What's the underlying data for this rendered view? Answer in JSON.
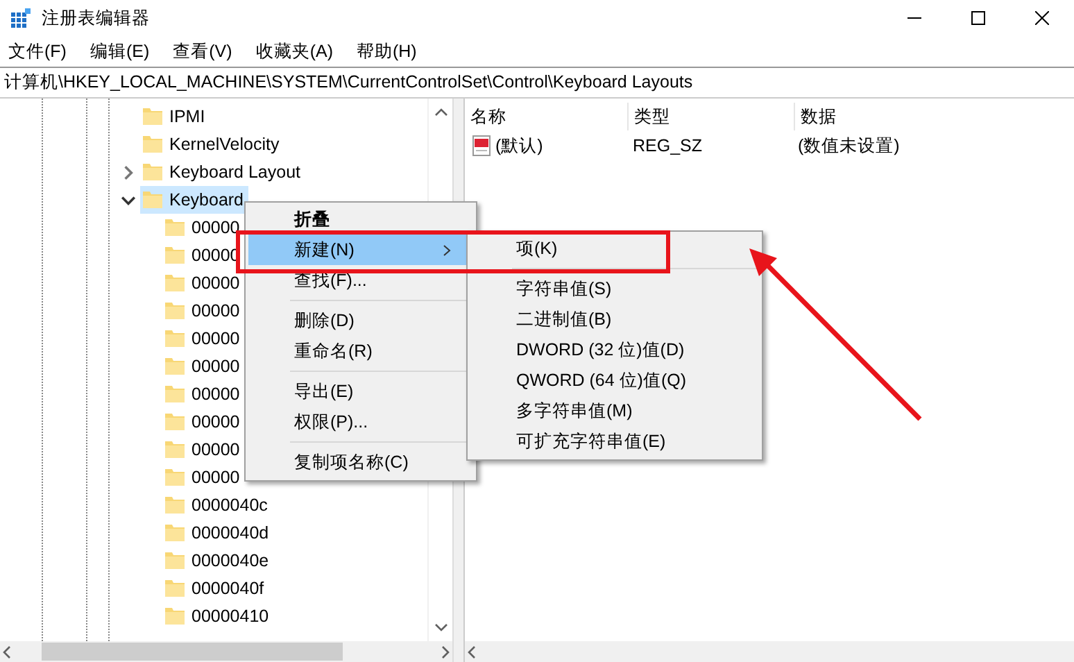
{
  "window": {
    "title": "注册表编辑器"
  },
  "menu_bar": [
    "文件(F)",
    "编辑(E)",
    "查看(V)",
    "收藏夹(A)",
    "帮助(H)"
  ],
  "address_bar": {
    "value": "计算机\\HKEY_LOCAL_MACHINE\\SYSTEM\\CurrentControlSet\\Control\\Keyboard Layouts"
  },
  "tree": {
    "items": [
      {
        "label": "IPMI",
        "selected": false
      },
      {
        "label": "KernelVelocity",
        "selected": false
      },
      {
        "label": "Keyboard Layout",
        "expanded": false,
        "selected": false
      },
      {
        "label": "Keyboard",
        "expanded": true,
        "selected": true,
        "children": [
          {
            "label": "00000",
            "selected": false
          },
          {
            "label": "00000",
            "selected": false
          },
          {
            "label": "00000",
            "selected": false
          },
          {
            "label": "00000",
            "selected": false
          },
          {
            "label": "00000",
            "selected": false
          },
          {
            "label": "00000",
            "selected": false
          },
          {
            "label": "00000",
            "selected": false
          },
          {
            "label": "00000",
            "selected": false
          },
          {
            "label": "00000",
            "selected": false
          },
          {
            "label": "00000",
            "selected": false
          },
          {
            "label": "0000040c",
            "selected": false
          },
          {
            "label": "0000040d",
            "selected": false
          },
          {
            "label": "0000040e",
            "selected": false
          },
          {
            "label": "0000040f",
            "selected": false
          },
          {
            "label": "00000410",
            "selected": false
          }
        ]
      }
    ]
  },
  "values_list": {
    "columns": [
      "名称",
      "类型",
      "数据"
    ],
    "rows": [
      {
        "cells": [
          "(默认)",
          "REG_SZ",
          "(数值未设置)"
        ]
      }
    ]
  },
  "context_menu": {
    "items": [
      {
        "kind": "item",
        "label": "折叠",
        "default": true,
        "selected": false,
        "submenu": false
      },
      {
        "kind": "item",
        "label": "新建(N)",
        "default": false,
        "selected": true,
        "submenu": true
      },
      {
        "kind": "item",
        "label": "查找(F)...",
        "default": false,
        "selected": false,
        "submenu": false
      },
      {
        "kind": "separator"
      },
      {
        "kind": "item",
        "label": "删除(D)",
        "default": false,
        "selected": false,
        "submenu": false
      },
      {
        "kind": "item",
        "label": "重命名(R)",
        "default": false,
        "selected": false,
        "submenu": false
      },
      {
        "kind": "separator"
      },
      {
        "kind": "item",
        "label": "导出(E)",
        "default": false,
        "selected": false,
        "submenu": false
      },
      {
        "kind": "item",
        "label": "权限(P)...",
        "default": false,
        "selected": false,
        "submenu": false
      },
      {
        "kind": "separator"
      },
      {
        "kind": "item",
        "label": "复制项名称(C)",
        "default": false,
        "selected": false,
        "submenu": false
      }
    ]
  },
  "submenu": {
    "items": [
      {
        "kind": "item",
        "label": "项(K)"
      },
      {
        "kind": "separator"
      },
      {
        "kind": "item",
        "label": "字符串值(S)"
      },
      {
        "kind": "item",
        "label": "二进制值(B)"
      },
      {
        "kind": "item",
        "label": "DWORD (32 位)值(D)"
      },
      {
        "kind": "item",
        "label": "QWORD (64 位)值(Q)"
      },
      {
        "kind": "item",
        "label": "多字符串值(M)"
      },
      {
        "kind": "item",
        "label": "可扩充字符串值(E)"
      }
    ]
  }
}
